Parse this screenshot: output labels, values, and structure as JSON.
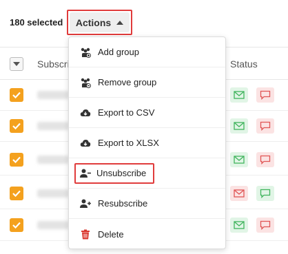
{
  "toolbar": {
    "selected_label": "180 selected",
    "actions_label": "Actions"
  },
  "table": {
    "columns": {
      "subscriber": "Subscrib",
      "status": "Status"
    },
    "rows": [
      {
        "checked": true,
        "email_status": "green",
        "sms_status": "red"
      },
      {
        "checked": true,
        "email_status": "green",
        "sms_status": "red"
      },
      {
        "checked": true,
        "email_status": "green",
        "sms_status": "red"
      },
      {
        "checked": true,
        "email_status": "red",
        "sms_status": "green"
      },
      {
        "checked": true,
        "email_status": "green",
        "sms_status": "red"
      }
    ]
  },
  "menu": {
    "items": [
      {
        "label": "Add group",
        "icon": "group-add-icon"
      },
      {
        "label": "Remove group",
        "icon": "group-remove-icon"
      },
      {
        "label": "Export to CSV",
        "icon": "cloud-download-icon"
      },
      {
        "label": "Export to XLSX",
        "icon": "cloud-download-icon"
      },
      {
        "label": "Unsubscribe",
        "icon": "user-minus-icon"
      },
      {
        "label": "Resubscribe",
        "icon": "user-plus-icon"
      },
      {
        "label": "Delete",
        "icon": "trash-icon"
      }
    ]
  },
  "colors": {
    "accent_orange": "#f4a11e",
    "highlight_red": "#e03b3b",
    "status_green": "#3fb45c",
    "status_red": "#e05555",
    "delete_red": "#d9342b"
  }
}
